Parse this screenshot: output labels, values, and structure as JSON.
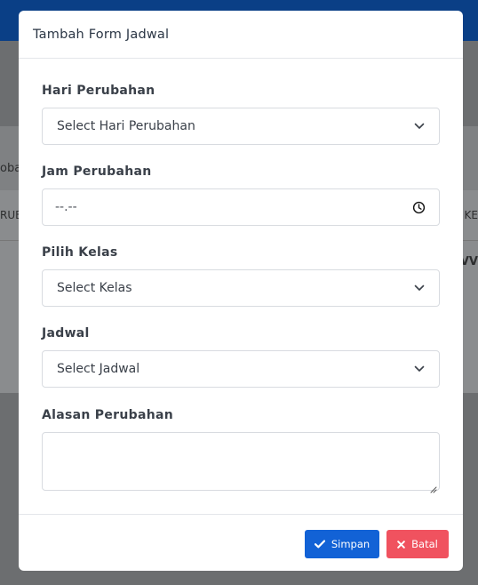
{
  "background": {
    "fragment_1": "obaha",
    "fragment_2": "RUB",
    "fragment_3": "KE",
    "fragment_4": "VV"
  },
  "modal": {
    "title": "Tambah Form Jadwal",
    "fields": {
      "hari": {
        "label": "Hari Perubahan",
        "value": "Select Hari Perubahan",
        "icon": "chevron-down-icon"
      },
      "jam": {
        "label": "Jam Perubahan",
        "value": "--.--",
        "icon": "clock-icon"
      },
      "kelas": {
        "label": "Pilih Kelas",
        "value": "Select Kelas",
        "icon": "chevron-down-icon"
      },
      "jadwal": {
        "label": "Jadwal",
        "value": "Select Jadwal",
        "icon": "chevron-down-icon"
      },
      "alasan": {
        "label": "Alasan Perubahan",
        "value": ""
      }
    },
    "buttons": {
      "save": {
        "label": "Simpan",
        "icon": "check-icon",
        "color": "#1262d6"
      },
      "cancel": {
        "label": "Batal",
        "icon": "close-icon",
        "color": "#f0525f"
      }
    }
  }
}
